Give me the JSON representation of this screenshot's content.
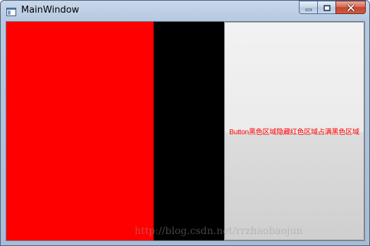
{
  "window": {
    "title": "MainWindow",
    "icon": "window-app-icon",
    "caption_buttons": {
      "minimize_icon": "minimize-icon",
      "maximize_icon": "maximize-icon",
      "close_icon": "close-icon"
    }
  },
  "content": {
    "red_region_color": "#ff0000",
    "black_region_color": "#000000",
    "button": {
      "label": "Button黑色区域隐藏红色区域占满黑色区域",
      "label_color": "#ff0000"
    }
  },
  "watermark": {
    "text": "http://blog.csdn.net/rrzhaobaojun"
  }
}
